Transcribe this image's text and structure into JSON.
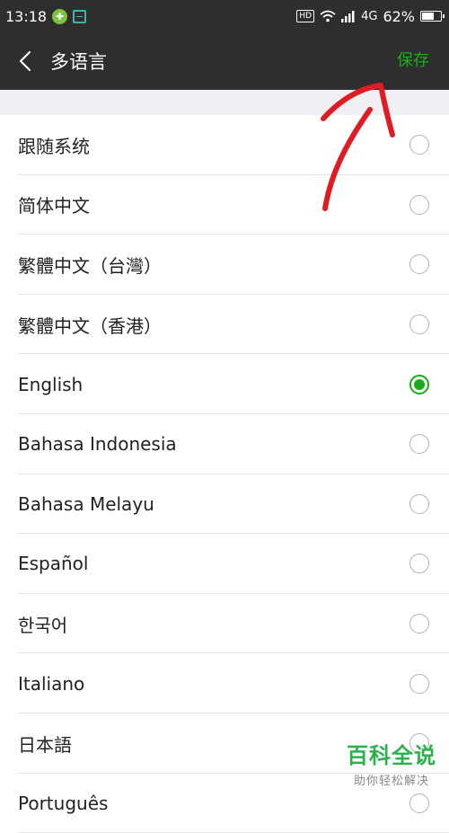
{
  "status_bar": {
    "time": "13:18",
    "hd": "HD",
    "network": "4G",
    "battery": "62%"
  },
  "header": {
    "title": "多语言",
    "save_label": "保存"
  },
  "languages": [
    {
      "label": "跟随系统",
      "selected": false
    },
    {
      "label": "简体中文",
      "selected": false
    },
    {
      "label": "繁體中文（台灣）",
      "selected": false
    },
    {
      "label": "繁體中文（香港）",
      "selected": false
    },
    {
      "label": "English",
      "selected": true
    },
    {
      "label": "Bahasa Indonesia",
      "selected": false
    },
    {
      "label": "Bahasa Melayu",
      "selected": false
    },
    {
      "label": "Español",
      "selected": false
    },
    {
      "label": "한국어",
      "selected": false
    },
    {
      "label": "Italiano",
      "selected": false
    },
    {
      "label": "日本語",
      "selected": false
    },
    {
      "label": "Português",
      "selected": false
    }
  ],
  "watermark": {
    "title": "百科全说",
    "subtitle": "助你轻松解决"
  },
  "colors": {
    "accent": "#1aad19",
    "header_bg": "#2e2e2e",
    "annotation": "#e01b24"
  }
}
